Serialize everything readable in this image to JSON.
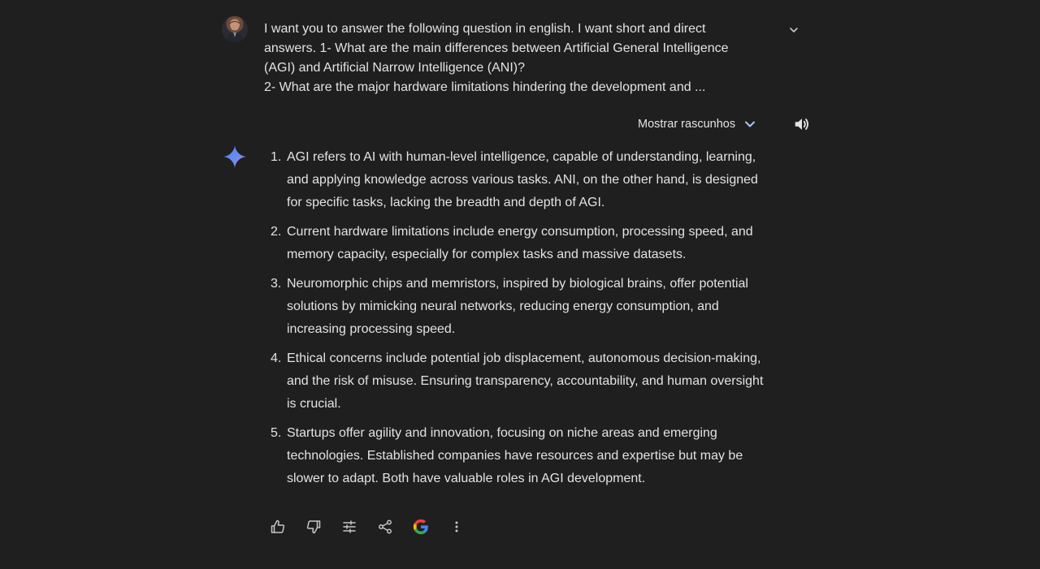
{
  "user_prompt": {
    "line1": " I  want you to answer the following question in english. I want short and direct",
    "line2": "answers. 1- What are the main differences between Artificial General Intelligence",
    "line3": "(AGI) and Artificial Narrow Intelligence (ANI)?",
    "line4": "2- What are the major hardware limitations hindering the development and ..."
  },
  "drafts": {
    "label": "Mostrar rascunhos"
  },
  "response": {
    "items": [
      {
        "number": "1.",
        "text": "AGI refers to AI with human-level intelligence, capable of understanding, learning, and applying knowledge across various tasks. ANI, on the other hand, is designed for specific tasks, lacking the breadth and depth of AGI."
      },
      {
        "number": "2.",
        "text": "Current hardware limitations include energy consumption, processing speed, and memory capacity, especially for complex tasks and massive datasets."
      },
      {
        "number": "3.",
        "text": "Neuromorphic chips and memristors, inspired by biological brains, offer potential solutions by mimicking neural networks, reducing energy consumption, and increasing processing speed."
      },
      {
        "number": "4.",
        "text": "Ethical concerns include potential job displacement, autonomous decision-making, and the risk of misuse. Ensuring transparency, accountability, and human oversight is crucial."
      },
      {
        "number": "5.",
        "text": "Startups offer agility and innovation, focusing on niche areas and emerging technologies. Established companies have resources and expertise but may be slower to adapt. Both have valuable roles in AGI development."
      }
    ]
  },
  "icons": {
    "avatar": "user-avatar",
    "expand": "chevron-down-icon",
    "drafts": "chevron-down-icon",
    "speaker": "speaker-icon",
    "gemini": "gemini-sparkle-icon",
    "thumbs_up": "thumbs-up-icon",
    "thumbs_down": "thumbs-down-icon",
    "modify": "tune-icon",
    "share": "share-icon",
    "google": "google-g-icon",
    "more": "more-vert-icon"
  },
  "colors": {
    "background": "#1f1f1f",
    "text": "#e3e3e3",
    "accent": "#a8c7fa"
  }
}
